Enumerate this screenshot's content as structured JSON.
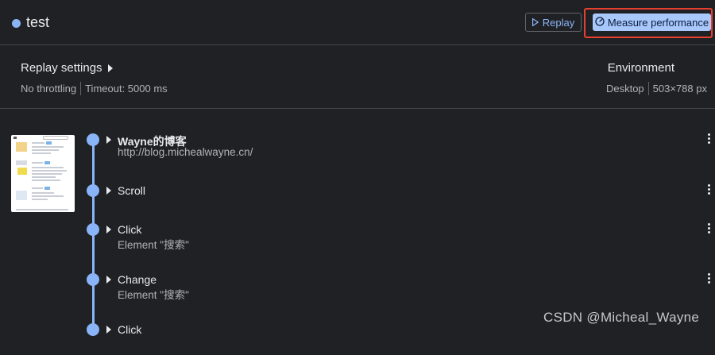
{
  "recording": {
    "title": "test"
  },
  "toolbar": {
    "replay_label": "Replay",
    "measure_label": "Measure performance"
  },
  "replay_settings": {
    "title": "Replay settings",
    "throttling": "No throttling",
    "timeout": "Timeout: 5000 ms"
  },
  "environment": {
    "title": "Environment",
    "device": "Desktop",
    "viewport": "503×788 px"
  },
  "steps": [
    {
      "title": "Wayne的博客",
      "subtitle": "http://blog.michealwayne.cn/"
    },
    {
      "title": "Scroll",
      "subtitle": ""
    },
    {
      "title": "Click",
      "subtitle": "Element \"搜索\""
    },
    {
      "title": "Change",
      "subtitle": "Element \"搜索\""
    },
    {
      "title": "Click",
      "subtitle": ""
    }
  ],
  "watermark": "CSDN @Micheal_Wayne",
  "colors": {
    "accent": "#8ab4f8",
    "highlight": "#e8402f",
    "background": "#202124"
  }
}
